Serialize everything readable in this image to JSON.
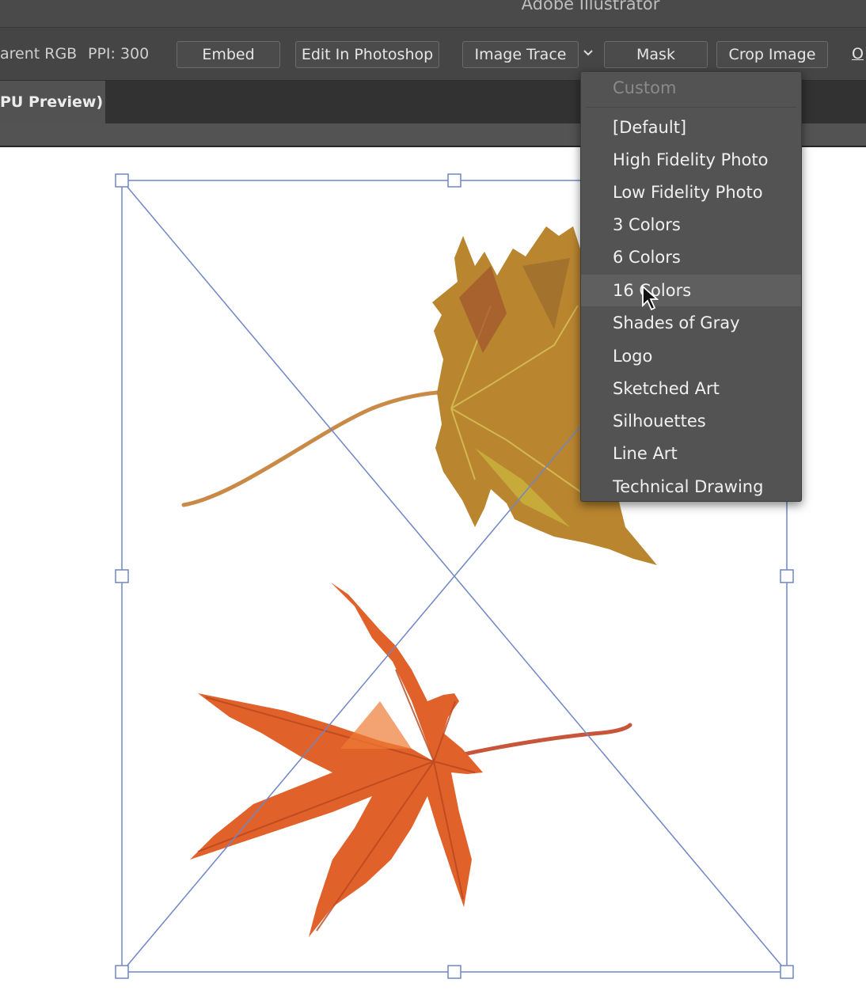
{
  "window": {
    "title": "Adobe Illustrator"
  },
  "control_bar": {
    "color_mode": "arent RGB",
    "ppi": "PPI: 300",
    "buttons": {
      "embed": "Embed",
      "edit_in_photoshop": "Edit In Photoshop",
      "image_trace": "Image Trace",
      "mask": "Mask",
      "crop_image": "Crop Image"
    },
    "overflow_label": "O"
  },
  "tabs": {
    "document_tab": "PU Preview)"
  },
  "trace_presets_menu": {
    "header": "Custom",
    "items": [
      "[Default]",
      "High Fidelity Photo",
      "Low Fidelity Photo",
      "3 Colors",
      "6 Colors",
      "16 Colors",
      "Shades of Gray",
      "Logo",
      "Sketched Art",
      "Silhouettes",
      "Line Art",
      "Technical Drawing"
    ],
    "hovered_item": "16 Colors"
  },
  "colors": {
    "chrome_dark": "#323232",
    "control_bar": "#454545",
    "menu_bg": "#535353",
    "selection_blue": "#6f86c6"
  },
  "icons": [
    "chevron-down-icon",
    "pointer-cursor-icon",
    "leaf-image"
  ]
}
